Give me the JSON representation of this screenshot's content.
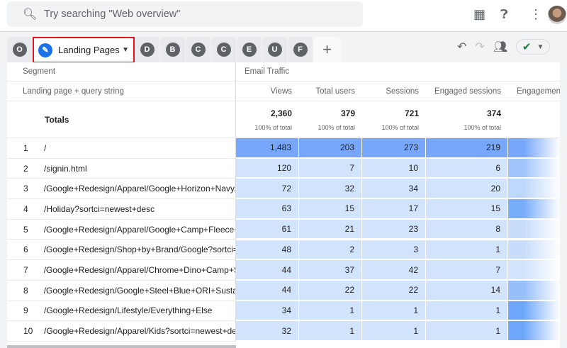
{
  "search": {
    "placeholder": "Try searching \"Web overview\""
  },
  "tabs": [
    {
      "letter": "O"
    },
    {
      "label": "Landing Pages",
      "active": true
    },
    {
      "letter": "D"
    },
    {
      "letter": "B"
    },
    {
      "letter": "C"
    },
    {
      "letter": "C"
    },
    {
      "letter": "E"
    },
    {
      "letter": "U"
    },
    {
      "letter": "F"
    }
  ],
  "add_tab": "+",
  "table": {
    "segment_label": "Segment",
    "segment_value": "Email Traffic",
    "dimension_header": "Landing page + query string",
    "columns": [
      "Views",
      "Total users",
      "Sessions",
      "Engaged sessions",
      "Engagement"
    ],
    "totals_label": "Totals",
    "totals": [
      {
        "value": "2,360",
        "pct": "100% of total"
      },
      {
        "value": "379",
        "pct": "100% of total"
      },
      {
        "value": "721",
        "pct": "100% of total"
      },
      {
        "value": "374",
        "pct": "100% of total"
      }
    ],
    "rows": [
      {
        "i": "1",
        "dim": "/",
        "v": [
          "1,483",
          "203",
          "273",
          "219"
        ],
        "eng": 0.9
      },
      {
        "i": "2",
        "dim": "/signin.html",
        "v": [
          "120",
          "7",
          "10",
          "6"
        ],
        "eng": 0.5
      },
      {
        "i": "3",
        "dim": "/Google+Redesign/Apparel/Google+Horizon+Navy...",
        "v": [
          "72",
          "32",
          "34",
          "20"
        ],
        "eng": 0.2
      },
      {
        "i": "4",
        "dim": "/Holiday?sortci=newest+desc",
        "v": [
          "63",
          "15",
          "17",
          "15"
        ],
        "eng": 0.9
      },
      {
        "i": "5",
        "dim": "/Google+Redesign/Apparel/Google+Camp+Fleece+C...",
        "v": [
          "61",
          "21",
          "23",
          "8"
        ],
        "eng": 0.1
      },
      {
        "i": "6",
        "dim": "/Google+Redesign/Shop+by+Brand/Google?sortci=...",
        "v": [
          "48",
          "2",
          "3",
          "1"
        ],
        "eng": 0.1
      },
      {
        "i": "7",
        "dim": "/Google+Redesign/Apparel/Chrome+Dino+Camp+Sh...",
        "v": [
          "44",
          "37",
          "42",
          "7"
        ],
        "eng": 0.0
      },
      {
        "i": "8",
        "dim": "/Google+Redesign/Google+Steel+Blue+ORI+Sustai...",
        "v": [
          "44",
          "22",
          "22",
          "14"
        ],
        "eng": 0.6
      },
      {
        "i": "9",
        "dim": "/Google+Redesign/Lifestyle/Everything+Else",
        "v": [
          "34",
          "1",
          "1",
          "1"
        ],
        "eng": 1.0
      },
      {
        "i": "10",
        "dim": "/Google+Redesign/Apparel/Kids?sortci=newest+desc",
        "v": [
          "32",
          "1",
          "1",
          "1"
        ],
        "eng": 1.0
      }
    ]
  },
  "colors": {
    "accent": "#1a73e8",
    "highlight": "#e2141c",
    "bar_strong": "#76a7fa",
    "bar_light": "#d2e3fc"
  }
}
